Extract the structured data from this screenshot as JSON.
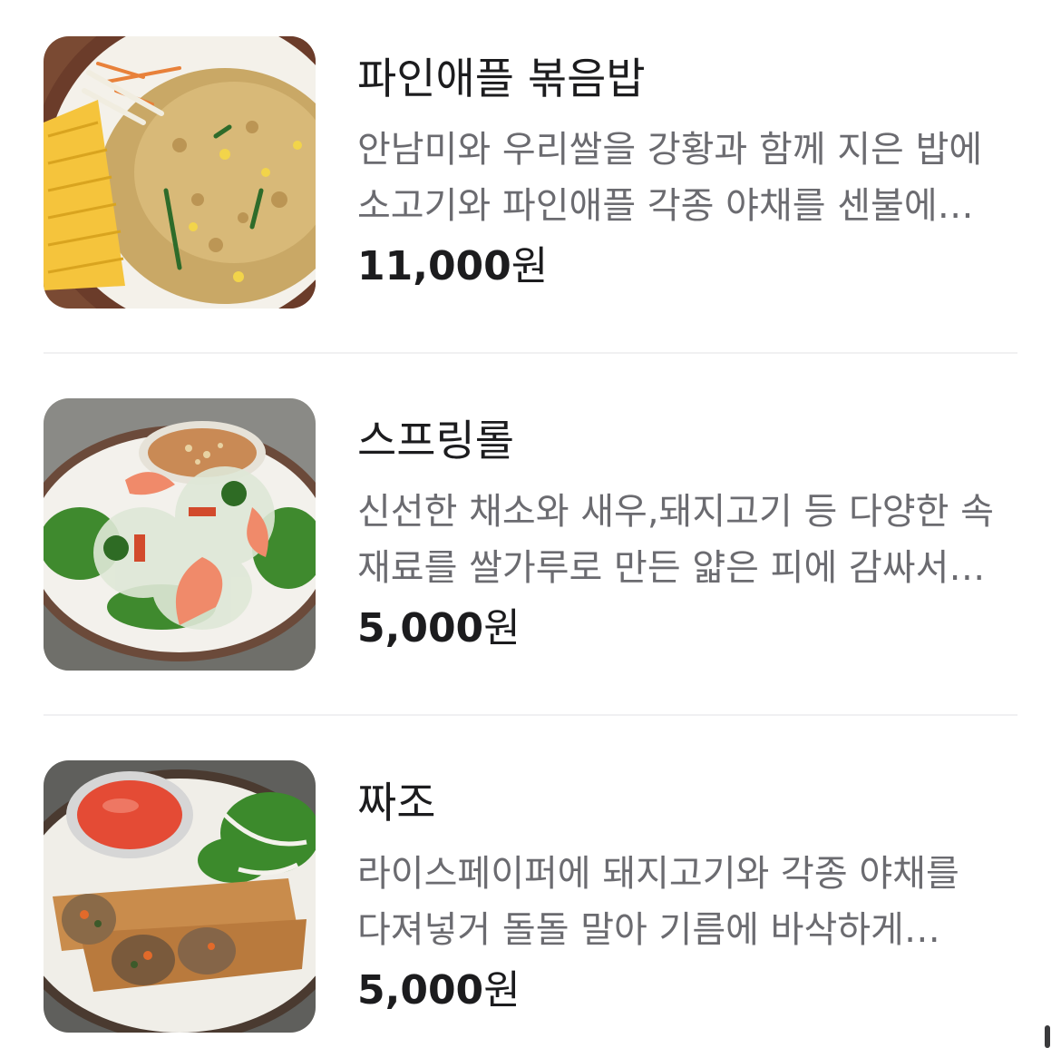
{
  "menu_items": [
    {
      "name": "파인애플 볶음밥",
      "description": "안남미와 우리쌀을 강황과 함께 지은 밥에 소고기와 파인애플 각종 야채를 센불에 볶아 만든 볶음밥",
      "price": "11,000",
      "currency": "원",
      "image_icon": "pineapple-fried-rice-photo"
    },
    {
      "name": "스프링롤",
      "description": "신선한 채소와 새우,돼지고기 등 다양한 속 재료를 쌀가루로 만든 얇은 피에 감싸서 만든 요리",
      "price": "5,000",
      "currency": "원",
      "image_icon": "spring-roll-photo"
    },
    {
      "name": "짜조",
      "description": "라이스페이퍼에 돼지고기와 각종 야채를 다져넣거 돌돌 말아 기름에 바삭하게 튀겨낸 요리",
      "price": "5,000",
      "currency": "원",
      "image_icon": "fried-spring-roll-photo"
    }
  ]
}
